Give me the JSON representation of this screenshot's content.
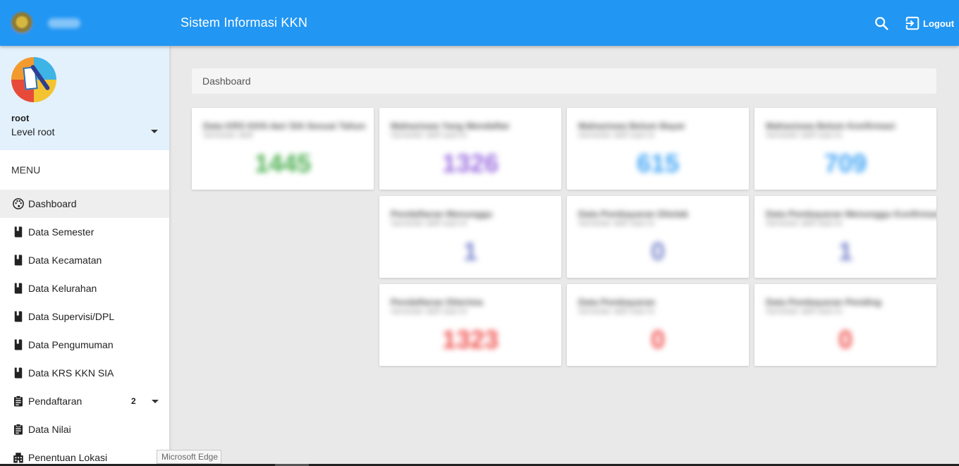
{
  "header": {
    "title": "Sistem Informasi KKN",
    "logout_label": "Logout",
    "color": "#2196f3"
  },
  "sidebar": {
    "user": {
      "name": "root",
      "level": "Level root"
    },
    "menu_header": "MENU",
    "items": [
      {
        "label": "Dashboard",
        "icon": "palette-icon",
        "active": true
      },
      {
        "label": "Data Semester",
        "icon": "book-icon"
      },
      {
        "label": "Data Kecamatan",
        "icon": "book-icon"
      },
      {
        "label": "Data Kelurahan",
        "icon": "book-icon"
      },
      {
        "label": "Data Supervisi/DPL",
        "icon": "book-icon"
      },
      {
        "label": "Data Pengumuman",
        "icon": "book-icon"
      },
      {
        "label": "Data KRS KKN SIA",
        "icon": "book-icon"
      },
      {
        "label": "Pendaftaran",
        "icon": "clipboard-icon",
        "badge": "2"
      },
      {
        "label": "Data Nilai",
        "icon": "clipboard-icon"
      },
      {
        "label": "Penentuan Lokasi",
        "icon": "building-icon"
      }
    ]
  },
  "main": {
    "breadcrumb": "Dashboard",
    "cards": [
      {
        "title": "Data KRS KKN dari SIA Sesuai Tahun",
        "subtitle": "Semester aktif",
        "value": "1445",
        "color": "#4caf50"
      },
      {
        "title": "Mahasiswa Yang Mendaftar",
        "subtitle": "Semester aktif saat ini",
        "value": "1326",
        "color": "#9c6fe0"
      },
      {
        "title": "Mahasiswa Belum Bayar",
        "subtitle": "Semester aktif saat ini",
        "value": "615",
        "color": "#42a5f5"
      },
      {
        "title": "Mahasiswa Belum Konfirmasi",
        "subtitle": "Semester aktif saat ini",
        "value": "709",
        "color": "#42a5f5"
      },
      {
        "title": "Pendaftaran Menunggu",
        "subtitle": "Semester aktif saat ini",
        "value": "1",
        "color": "#7986cb"
      },
      {
        "title": "Data Pembayaran Ditolak",
        "subtitle": "Semester aktif saat ini",
        "value": "0",
        "color": "#7986cb"
      },
      {
        "title": "Data Pembayaran Menunggu Konfirmasi",
        "subtitle": "Semester aktif saat ini",
        "value": "1",
        "color": "#7986cb"
      },
      {
        "title": "Pendaftaran Diterima",
        "subtitle": "Semester aktif saat ini",
        "value": "1323",
        "color": "#ef5350"
      },
      {
        "title": "Data Pembayaran",
        "subtitle": "Semester aktif saat ini",
        "value": "0",
        "color": "#ef5350"
      },
      {
        "title": "Data Pembayaran Pending",
        "subtitle": "Semester aktif saat ini",
        "value": "0",
        "color": "#ef5350"
      }
    ]
  },
  "tooltip": "Microsoft Edge"
}
